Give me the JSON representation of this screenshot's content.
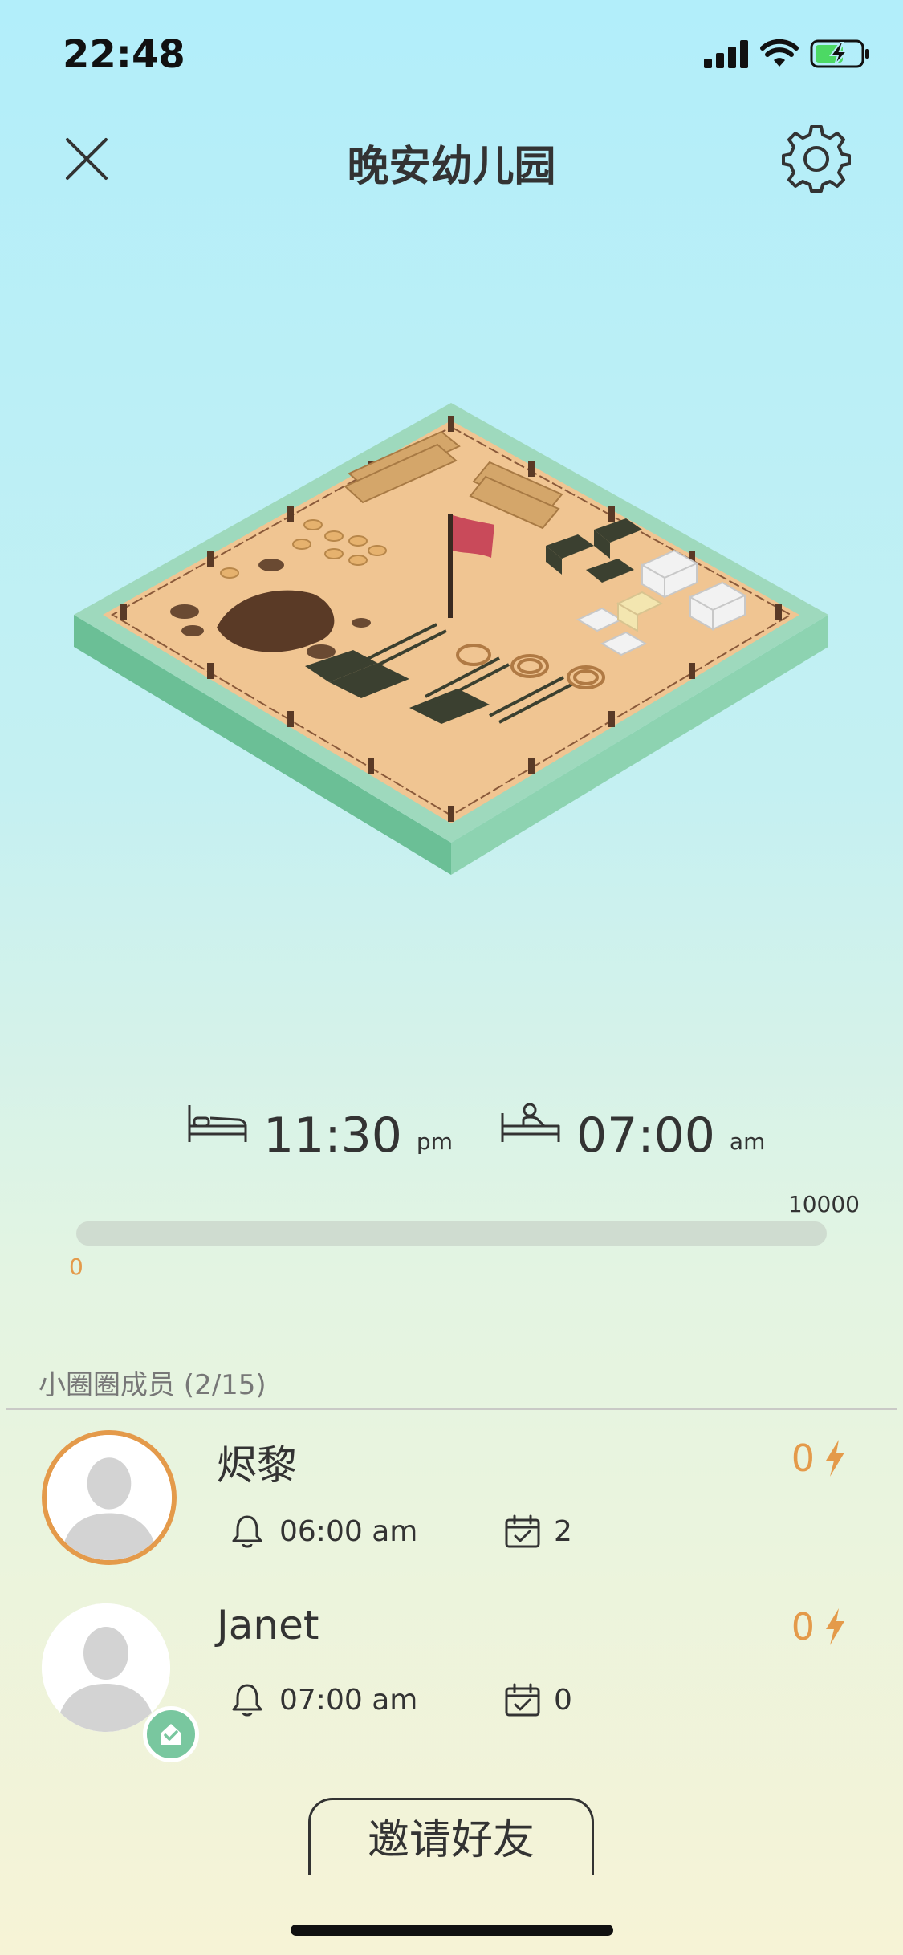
{
  "status_bar": {
    "time": "22:48"
  },
  "header": {
    "title": "晚安幼儿园",
    "close_icon": "close-icon",
    "settings_icon": "gear-icon"
  },
  "schedule": {
    "bedtime": {
      "time": "11:30",
      "ampm": "pm",
      "icon": "bed-icon"
    },
    "wake": {
      "time": "07:00",
      "ampm": "am",
      "icon": "wake-up-icon"
    }
  },
  "progress": {
    "min_label": "0",
    "max_label": "10000",
    "value": 0
  },
  "members": {
    "title": "小圈圈成员 (2/15)",
    "list": [
      {
        "name": "烬黎",
        "alarm": "06:00 am",
        "checkins": "2",
        "energy": "0"
      },
      {
        "name": "Janet",
        "alarm": "07:00 am",
        "checkins": "0",
        "energy": "0"
      }
    ]
  },
  "invite": {
    "label": "邀请好友"
  },
  "colors": {
    "accent": "#e49a4a",
    "badge": "#79c79f",
    "track": "#cfdcd0"
  }
}
